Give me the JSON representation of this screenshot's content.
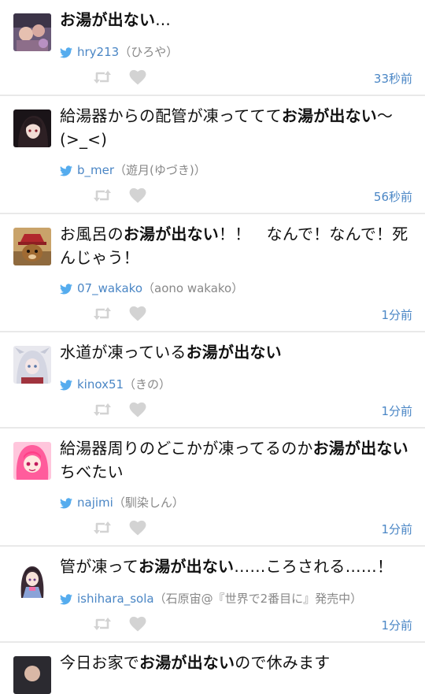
{
  "tweets": [
    {
      "pre": "",
      "bold": "お湯が出ない",
      "post": "...",
      "screen_name": "hry213",
      "name": "（ひろや）",
      "time": "33秒前"
    },
    {
      "pre": "給湯器からの配管が凍っててて",
      "bold": "お湯が出ない",
      "post": "〜(>_<)",
      "screen_name": "b_mer",
      "name": "（遊月(ゆづき)）",
      "time": "56秒前"
    },
    {
      "pre": "お風呂の",
      "bold": "お湯が出ない",
      "post": "！！　なんで！なんで！死んじゃう！",
      "screen_name": "07_wakako",
      "name": "（aono wakako）",
      "time": "1分前"
    },
    {
      "pre": "水道が凍っている",
      "bold": "お湯が出ない",
      "post": "",
      "screen_name": "kinox51",
      "name": "（きの）",
      "time": "1分前"
    },
    {
      "pre": "給湯器周りのどこかが凍ってるのか",
      "bold": "お湯が出ない",
      "post": "　ちべたい",
      "screen_name": "najimi",
      "name": "（馴染しん）",
      "time": "1分前"
    },
    {
      "pre": "管が凍って",
      "bold": "お湯が出ない",
      "post": "……ころされる……！",
      "screen_name": "ishihara_sola",
      "name": "（石原宙@『世界で2番目に』発売中）",
      "time": "1分前"
    },
    {
      "pre": "今日お家で",
      "bold": "お湯が出ない",
      "post": "ので休みます",
      "screen_name": "",
      "name": "",
      "time": ""
    }
  ],
  "icons": {
    "bird": "twitter-bird-icon",
    "retweet": "retweet-icon",
    "like": "heart-icon"
  },
  "colors": {
    "link": "#4a86c5",
    "bird": "#55acee",
    "action": "#d3d3d3",
    "divider": "#e9e9e9"
  }
}
